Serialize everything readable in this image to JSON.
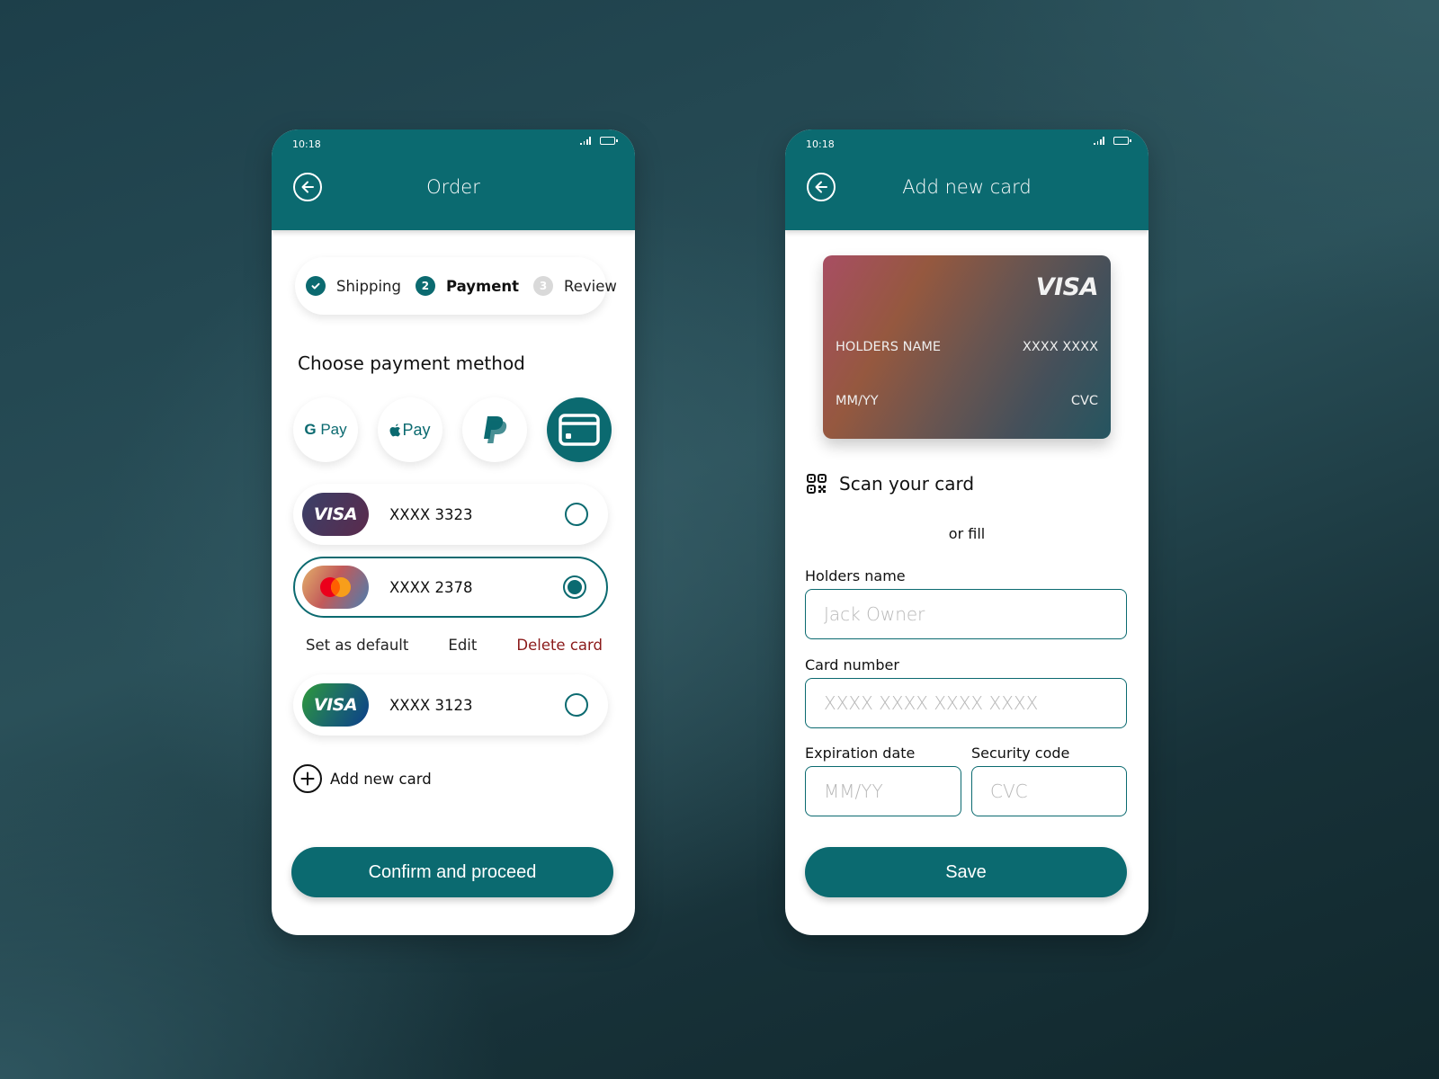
{
  "colors": {
    "primary": "#0b6a70",
    "danger": "#8b1a1a",
    "placeholder": "#b8b8b8",
    "step_inactive": "#d9d9d9"
  },
  "order_screen": {
    "status_bar": {
      "time": "10:18",
      "icons": [
        "signal-icon",
        "battery-icon"
      ]
    },
    "header": {
      "back_icon": "arrow-left-circle-icon",
      "title": "Order"
    },
    "stepper": [
      {
        "label": "Shipping",
        "state": "done",
        "marker": "✓"
      },
      {
        "label": "Payment",
        "state": "active",
        "marker": "2"
      },
      {
        "label": "Review",
        "state": "todo",
        "marker": "3"
      }
    ],
    "section_title": "Choose payment method",
    "payment_methods": [
      {
        "name": "Google Pay",
        "label": "G Pay",
        "icon": "gpay-icon",
        "selected": false
      },
      {
        "name": "Apple Pay",
        "label": "Pay",
        "icon": "applepay-icon",
        "selected": false
      },
      {
        "name": "PayPal",
        "label": "P",
        "icon": "paypal-icon",
        "selected": false
      },
      {
        "name": "Card",
        "label": "",
        "icon": "credit-card-icon",
        "selected": true
      }
    ],
    "saved_cards": [
      {
        "brand": "VISA",
        "number": "XXXX 3323",
        "selected": false
      },
      {
        "brand": "Mastercard",
        "number": "XXXX 2378",
        "selected": true
      },
      {
        "brand": "VISA",
        "number": "XXXX 3123",
        "selected": false
      }
    ],
    "card_actions": {
      "set_default": "Set as default",
      "edit": "Edit",
      "delete": "Delete card"
    },
    "add_card_label": "Add new card",
    "confirm_label": "Confirm and proceed"
  },
  "add_card_screen": {
    "status_bar": {
      "time": "10:18",
      "icons": [
        "signal-icon",
        "battery-icon"
      ]
    },
    "header": {
      "back_icon": "arrow-left-circle-icon",
      "title": "Add new card"
    },
    "card_preview": {
      "brand": "VISA",
      "holder": "HOLDERS NAME",
      "number": "XXXX XXXX",
      "expiry": "MM/YY",
      "cvc": "CVC"
    },
    "scan_label": "Scan your card",
    "or_fill": "or fill",
    "fields": {
      "holder": {
        "label": "Holders name",
        "value": "",
        "placeholder": "Jack Owner"
      },
      "number": {
        "label": "Card number",
        "value": "",
        "placeholder": "XXXX XXXX XXXX XXXX"
      },
      "expiry": {
        "label": "Expiration date",
        "value": "",
        "placeholder": "MM/YY"
      },
      "cvc": {
        "label": "Security code",
        "value": "",
        "placeholder": "CVC"
      }
    },
    "save_label": "Save"
  }
}
